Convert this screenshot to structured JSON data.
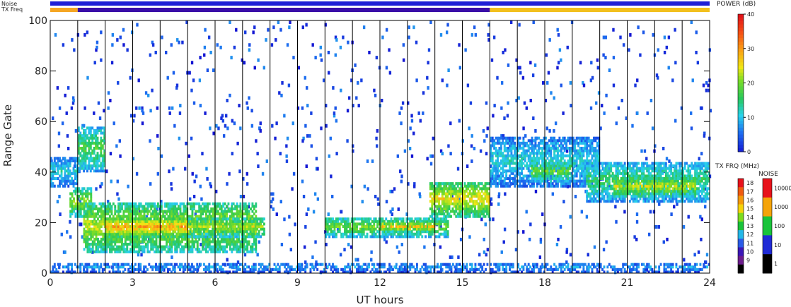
{
  "chart_data": {
    "type": "heatmap",
    "xlabel": "UT hours",
    "ylabel": "Range Gate",
    "xlim": [
      0,
      24
    ],
    "ylim": [
      0,
      100
    ],
    "x_ticks": [
      0,
      3,
      6,
      9,
      12,
      15,
      18,
      21,
      24
    ],
    "y_ticks": [
      0,
      20,
      40,
      60,
      80,
      100
    ],
    "scan_boundaries_ut": [
      1,
      2,
      3,
      4,
      5,
      6,
      7,
      8,
      9,
      10,
      11,
      12,
      13,
      14,
      15,
      16,
      17,
      18,
      19,
      20,
      21,
      22,
      23
    ],
    "top_strips": {
      "noise_label": "Noise",
      "txfreq_label": "TX Freq",
      "noise_color": "#1f1fd6",
      "txfreq_segments": [
        {
          "from": 0,
          "to": 1,
          "color": "#f5a623"
        },
        {
          "from": 1,
          "to": 16,
          "color": "#3a0ea8"
        },
        {
          "from": 16,
          "to": 24,
          "color": "#f2c01e"
        }
      ]
    },
    "power_scale": {
      "title": "POWER (dB)",
      "ticks": [
        "40",
        "30",
        "20",
        "10",
        "0"
      ],
      "min": 0,
      "max": 40
    },
    "txfreq_scale": {
      "title": "TX FRQ (MHz)",
      "ticks": [
        "18",
        "17",
        "16",
        "15",
        "14",
        "13",
        "12",
        "11",
        "10",
        "9"
      ],
      "colors": [
        "#e8121b",
        "#f05a10",
        "#f59a0a",
        "#f5d40a",
        "#7ddc1e",
        "#19c43a",
        "#23b8e8",
        "#2a5be8",
        "#3b16b8",
        "#6b1c8c",
        "#000000"
      ]
    },
    "noise_scale": {
      "title": "NOISE",
      "ticks": [
        "10000",
        "1000",
        "100",
        "10",
        "1"
      ],
      "colors": [
        "#e8121b",
        "#f5a40a",
        "#19c43a",
        "#1f2ad6",
        "#000000"
      ]
    },
    "echo_regions": [
      {
        "x0": 0.0,
        "x1": 1.0,
        "y0": 34,
        "y1": 46,
        "power": 12
      },
      {
        "x0": 1.0,
        "x1": 2.0,
        "y0": 40,
        "y1": 58,
        "power": 18
      },
      {
        "x0": 0.7,
        "x1": 1.5,
        "y0": 22,
        "y1": 34,
        "power": 22
      },
      {
        "x0": 1.2,
        "x1": 7.5,
        "y0": 8,
        "y1": 28,
        "power": 24
      },
      {
        "x0": 2.0,
        "x1": 5.0,
        "y0": 14,
        "y1": 22,
        "power": 30
      },
      {
        "x0": 5.0,
        "x1": 7.8,
        "y0": 14,
        "y1": 22,
        "power": 22
      },
      {
        "x0": 10.0,
        "x1": 14.5,
        "y0": 14,
        "y1": 22,
        "power": 20
      },
      {
        "x0": 12.0,
        "x1": 14.0,
        "y0": 16,
        "y1": 20,
        "power": 28
      },
      {
        "x0": 13.8,
        "x1": 16.0,
        "y0": 22,
        "y1": 36,
        "power": 26
      },
      {
        "x0": 16.0,
        "x1": 20.0,
        "y0": 34,
        "y1": 54,
        "power": 12
      },
      {
        "x0": 17.5,
        "x1": 19.0,
        "y0": 36,
        "y1": 44,
        "power": 20
      },
      {
        "x0": 19.5,
        "x1": 24.0,
        "y0": 28,
        "y1": 44,
        "power": 16
      },
      {
        "x0": 20.5,
        "x1": 23.5,
        "y0": 30,
        "y1": 38,
        "power": 24
      },
      {
        "x0": 0.0,
        "x1": 24.0,
        "y0": 0,
        "y1": 4,
        "power": 8
      }
    ]
  }
}
